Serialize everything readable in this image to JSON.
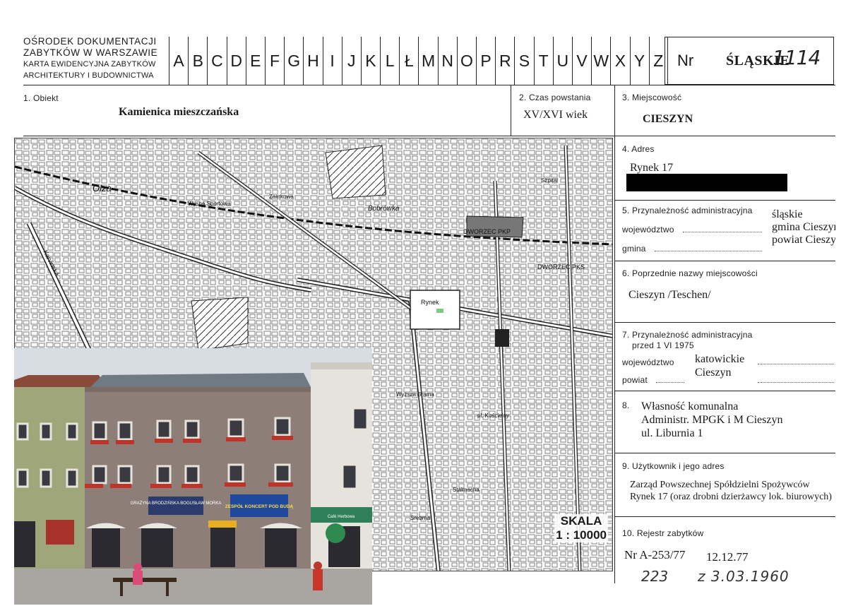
{
  "header": {
    "org_lines": [
      "OŚRODEK DOKUMENTACJI",
      "ZABYTKÓW W WARSZAWIE",
      "KARTA EWIDENCYJNA ZABYTKÓW",
      "ARCHITEKTURY I BUDOWNICTWA"
    ],
    "letters": [
      "A",
      "B",
      "C",
      "D",
      "E",
      "F",
      "G",
      "H",
      "I",
      "J",
      "K",
      "L",
      "Ł",
      "M",
      "N",
      "O",
      "P",
      "R",
      "S",
      "T",
      "U",
      "V",
      "W",
      "X",
      "Y",
      "Z"
    ],
    "nr_label": "Nr",
    "nr_value": "ŚLĄSKIE",
    "nr_handwritten": "1114"
  },
  "fields": {
    "obiekt_label": "1. Obiekt",
    "obiekt_value": "Kamienica mieszczańska",
    "czas_label": "2. Czas powstania",
    "czas_value": "XV/XVI wiek",
    "miejscowosc_label": "3. Miejscowość",
    "miejscowosc_value": "CIESZYN",
    "adres_label": "4. Adres",
    "adres_value": "Rynek 17",
    "przyn_label": "5. Przynależność administracyjna",
    "wojewodztwo_label": "województwo",
    "gmina_label": "gmina",
    "przyn_values": [
      "śląskie",
      "gmina Cieszyn",
      "powiat Cieszyn"
    ],
    "poprzednie_label": "6. Poprzednie nazwy miejscowości",
    "poprzednie_value": "Cieszyn /Teschen/",
    "przyn75_label_1": "7. Przynależność administracyjna",
    "przyn75_label_2": "przed 1 VI 1975",
    "woj75_label": "województwo",
    "woj75_value": "katowickie",
    "powiat75_label": "powiat",
    "powiat75_value": "Cieszyn",
    "wlasnosc_label": "8.",
    "wlasnosc_lines": [
      "Własność komunalna",
      "Administr. MPGK i M Cieszyn",
      "ul. Liburnia 1"
    ],
    "uzytkownik_label": "9. Użytkownik i jego adres",
    "uzytkownik_lines": [
      "Zarząd Powszechnej Spółdzielni Spożywców",
      "Rynek 17 (oraz drobni dzierżawcy lok. biurowych)"
    ],
    "rejestr_label": "10. Rejestr zabytków",
    "rejestr_nr": "Nr A-253/77",
    "rejestr_date": "12.12.77",
    "rejestr_hand_1": "223",
    "rejestr_hand_2": "z 3.03.1960"
  },
  "map": {
    "scale_label": "SKALA",
    "scale_value": "1 : 10000",
    "labels": [
      "Olza",
      "Bobrówka",
      "Rynek",
      "DWORZEC PKP",
      "DWORZEC PKS",
      "Szpital",
      "Karvinská",
      "pl. Kościelny",
      "Wyższa Brama",
      "Stalmacha",
      "Srebrna",
      "Zamkowa",
      "Wyspa Sportowa"
    ]
  },
  "photo": {
    "signs": [
      "GRAŻYNA BRODZIŃSKA BOGUSŁAW MORKA",
      "ZESPÓŁ KONCERT POD BUDĄ",
      "Café Herbowa"
    ]
  }
}
